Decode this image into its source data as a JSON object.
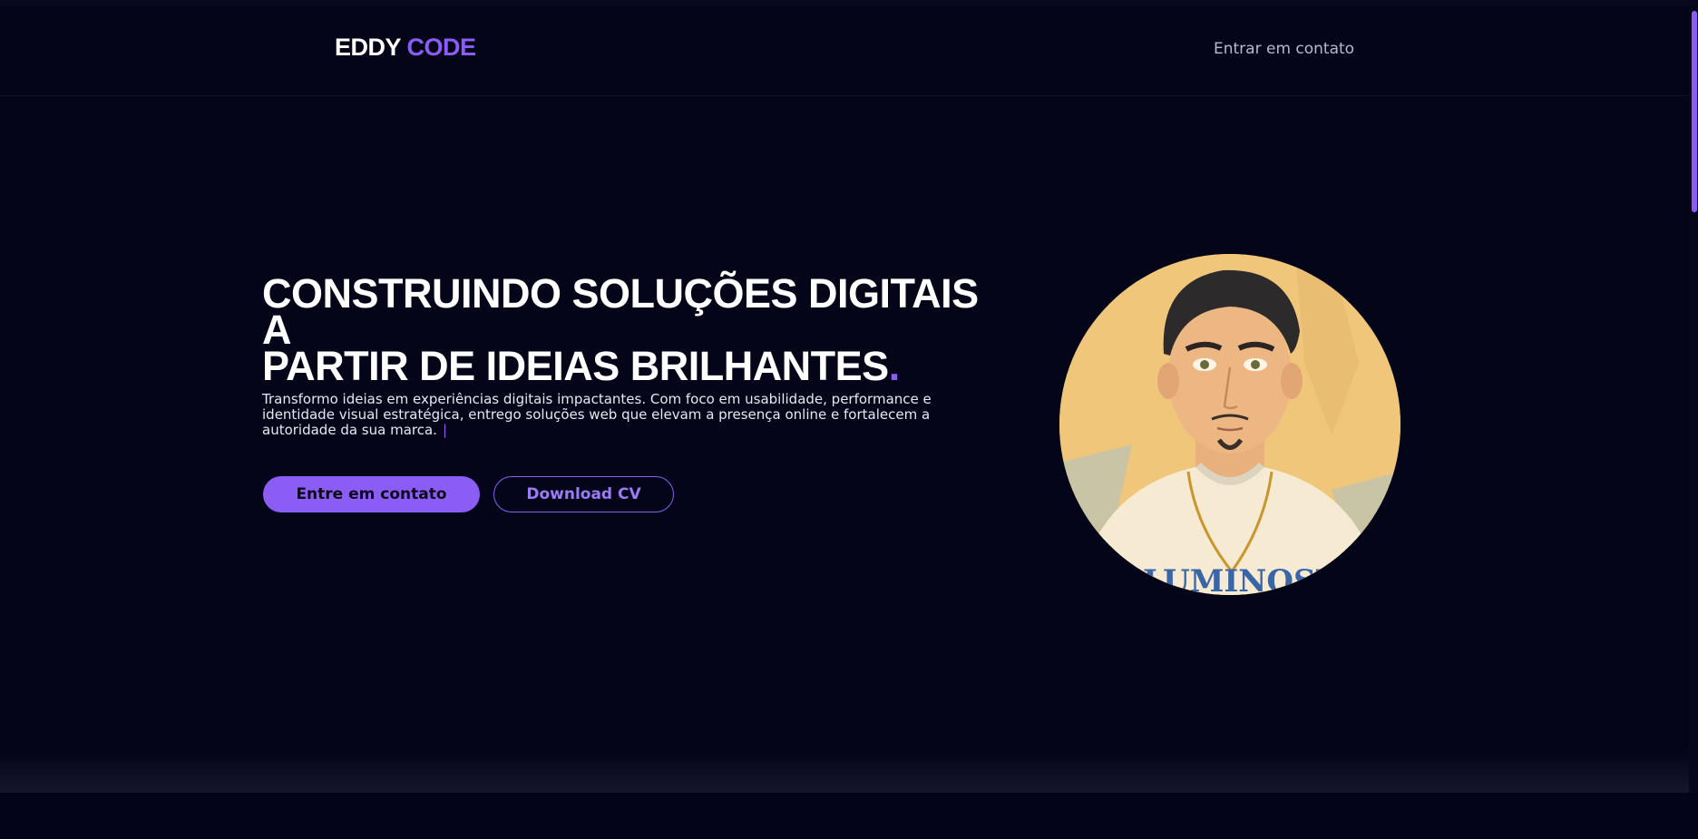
{
  "header": {
    "logo_part1": "EDDY",
    "logo_part2": "CODE",
    "nav_contact": "Entrar em contato"
  },
  "hero": {
    "title_line1": "CONSTRUINDO SOLUÇÕES DIGITAIS A",
    "title_line2": "PARTIR DE IDEIAS BRILHANTES",
    "title_dot": ".",
    "description": "Transformo ideias em experiências digitais impactantes. Com foco em usabilidade, performance e identidade visual estratégica, entrego soluções web que elevam a presença online e fortalecem a autoridade da sua marca.",
    "caret": "|",
    "primary_button": "Entre em contato",
    "secondary_button": "Download CV"
  },
  "avatar": {
    "shirt_text": "ILLUMINOSTI"
  },
  "colors": {
    "background": "#040519",
    "accent": "#8b5cf6",
    "text": "#ffffff"
  }
}
